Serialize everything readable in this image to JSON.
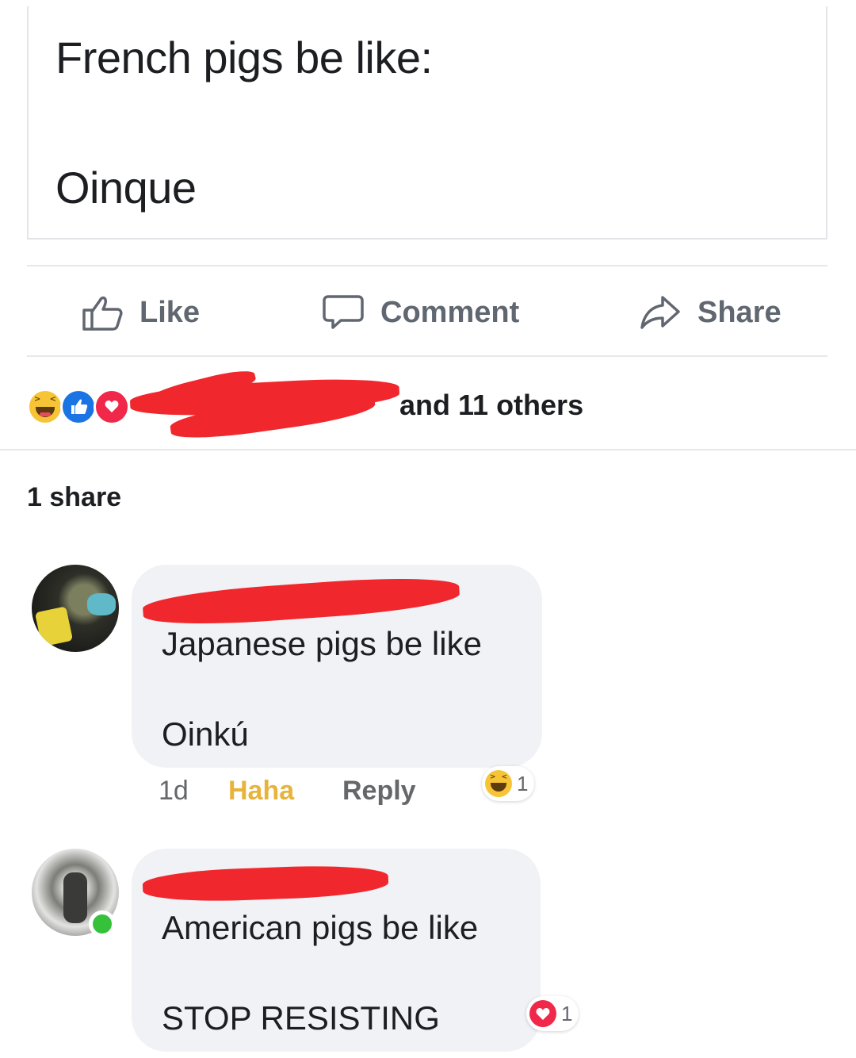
{
  "post": {
    "line1": "French pigs be like:",
    "line2": "Oinque"
  },
  "actions": {
    "like_label": "Like",
    "comment_label": "Comment",
    "share_label": "Share"
  },
  "reactions": {
    "icons": [
      "haha-icon",
      "like-icon",
      "love-icon"
    ],
    "others_text": "and 11 others",
    "colors": {
      "like": "#1b74e4",
      "love": "#f02849",
      "haha": "#f7c436",
      "redaction": "#f0282d"
    }
  },
  "shares": {
    "count_text": "1 share"
  },
  "comments": [
    {
      "line1": "Japanese pigs be like",
      "line2": "Oinkú",
      "time": "1d",
      "reaction_label": "Haha",
      "reply_label": "Reply",
      "reaction_count": "1"
    },
    {
      "line1": "American pigs be like",
      "line2": "STOP RESISTING",
      "reaction_count": "1",
      "online": true
    }
  ]
}
